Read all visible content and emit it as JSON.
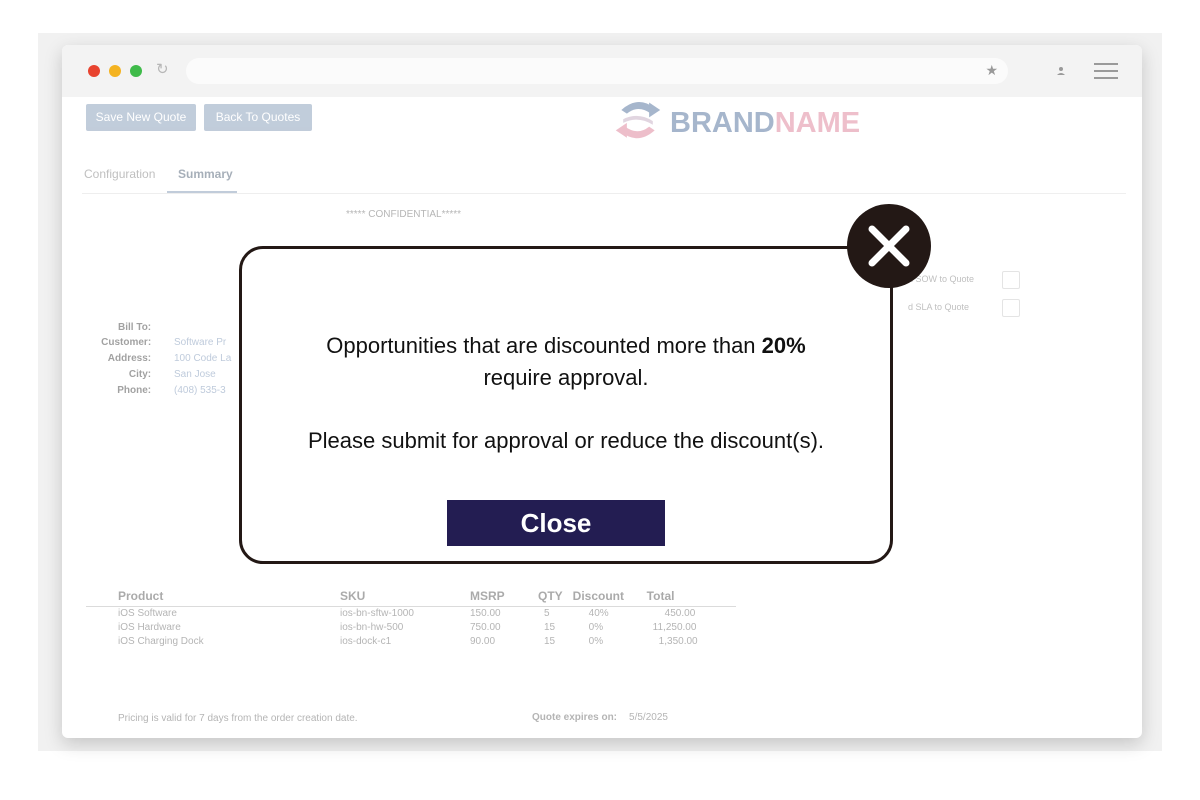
{
  "toolbar": {
    "save_label": "Save New Quote",
    "back_label": "Back To Quotes"
  },
  "brand": {
    "part1": "BRAND",
    "part2": "NAME"
  },
  "tabs": [
    {
      "label": "Configuration"
    },
    {
      "label": "Summary"
    }
  ],
  "confidential": "***** CONFIDENTIAL*****",
  "options": [
    {
      "label": "d SOW to Quote"
    },
    {
      "label": "d SLA to Quote"
    }
  ],
  "bill_to": {
    "title": "Bill To:",
    "customer_label": "Customer:",
    "customer": "Software Pr",
    "address_label": "Address:",
    "address": "100 Code La",
    "city_label": "City:",
    "city": "San Jose",
    "phone_label": "Phone:",
    "phone": "(408) 535-3"
  },
  "table": {
    "headers": [
      "Product",
      "SKU",
      "MSRP",
      "QTY",
      "Discount",
      "Total"
    ],
    "rows": [
      [
        "iOS Software",
        "ios-bn-sftw-1000",
        "150.00",
        "5",
        "40%",
        "450.00"
      ],
      [
        "iOS Hardware",
        "ios-bn-hw-500",
        "750.00",
        "15",
        "0%",
        "11,250.00"
      ],
      [
        "iOS Charging Dock",
        "ios-dock-c1",
        "90.00",
        "15",
        "0%",
        "1,350.00"
      ]
    ]
  },
  "footer": {
    "validity": "Pricing is valid for 7 days from the order creation date.",
    "expires_label": "Quote expires on:",
    "expires_date": "5/5/2025"
  },
  "modal": {
    "line1_prefix": "Opportunities that are discounted more than ",
    "line1_highlight": "20%",
    "line2": "require approval.",
    "line3": "Please submit for approval or reduce the discount(s).",
    "close_label": "Close"
  },
  "colors": {
    "modal_button": "#231d52",
    "modal_border": "#231815",
    "brand_blue": "#5d7aa3",
    "brand_pink": "#e08aa0"
  }
}
